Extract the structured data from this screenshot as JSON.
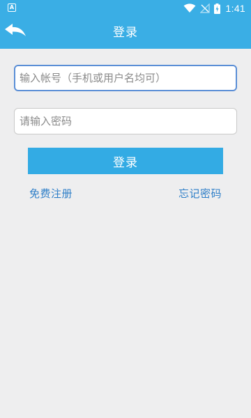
{
  "status_bar": {
    "notification_glyph": "A",
    "time": "1:41",
    "icons": [
      "wifi-icon",
      "no-signal-icon",
      "battery-charging-icon"
    ]
  },
  "app_bar": {
    "title": "登录",
    "back_icon": "back-arrow-icon"
  },
  "form": {
    "account_placeholder": "输入帐号（手机或用户名均可）",
    "account_value": "",
    "password_placeholder": "请输入密码",
    "password_value": "",
    "login_label": "登录"
  },
  "links": {
    "register_label": "免费注册",
    "forgot_label": "忘记密码"
  },
  "colors": {
    "accent": "#3aaee5",
    "link": "#2f7fc8",
    "background": "#eeeeef",
    "focus_border": "#5a8ed6"
  }
}
